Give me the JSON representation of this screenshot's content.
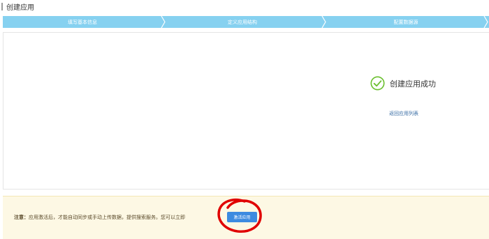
{
  "page": {
    "title": "创建应用"
  },
  "steps": [
    {
      "label": "填写基本信息"
    },
    {
      "label": "定义应用结构"
    },
    {
      "label": "配置数据源"
    }
  ],
  "result": {
    "success_text": "创建应用成功",
    "back_link": "返回应用列表"
  },
  "notice": {
    "label": "注意：",
    "text": "应用激活后，才能自动同步或手动上传数据，提供搜索服务。您可以立即",
    "activate_button": "激活应用"
  },
  "colors": {
    "step_bar": "#86d1f0",
    "success_green": "#6abf2e",
    "button_blue": "#3d8be0",
    "notice_bg": "#fdf8e4",
    "annotation_red": "#e00000"
  },
  "icons": {
    "success": "check-circle-icon",
    "step_separator": "chevron-right-icon",
    "annotation": "hand-drawn-circle"
  }
}
